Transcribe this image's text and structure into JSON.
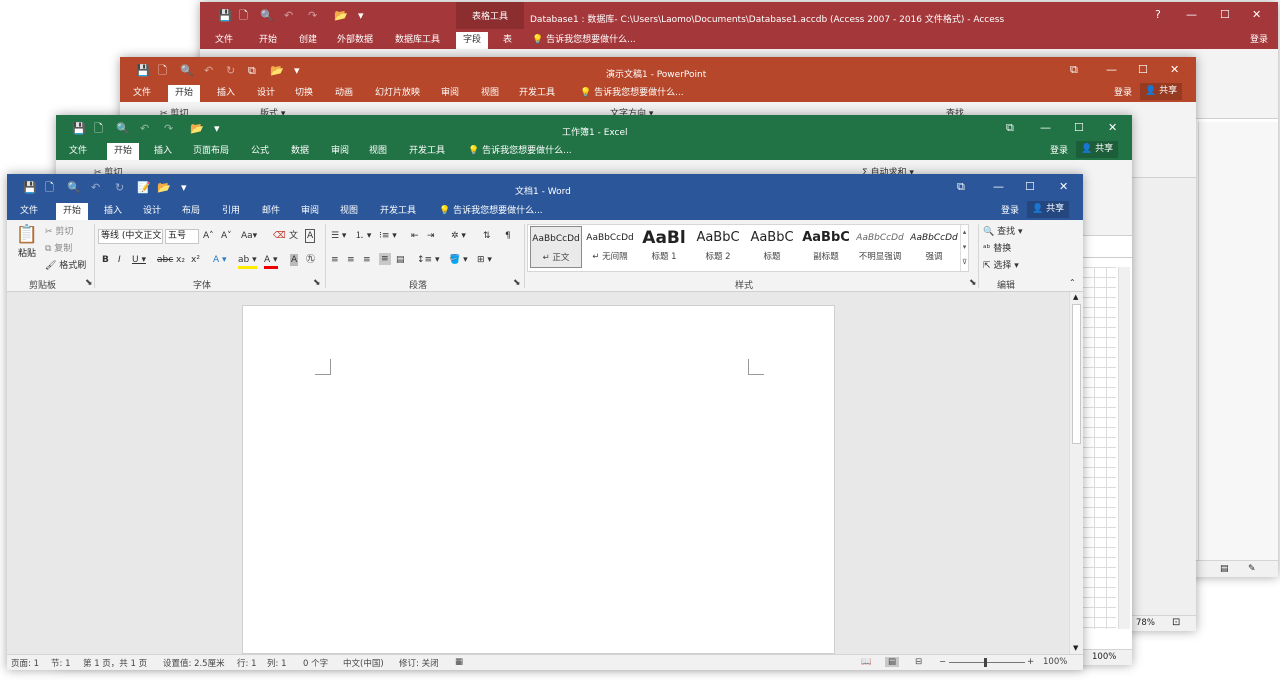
{
  "access": {
    "qat": [
      "💾",
      "🗋",
      "🔍",
      "↶",
      "↷",
      "📂",
      "▾"
    ],
    "context_tab": "表格工具",
    "title": "Database1 : 数据库- C:\\Users\\Laomo\\Documents\\Database1.accdb (Access 2007 - 2016 文件格式) - Access",
    "controls": [
      "?",
      "—",
      "☐",
      "✕"
    ],
    "tabs": [
      "文件",
      "开始",
      "创建",
      "外部数据",
      "数据库工具",
      "字段",
      "表"
    ],
    "active_tab": 5,
    "tell_me": "告诉我您想要做什么...",
    "login": "登录"
  },
  "ppt": {
    "qat": [
      "💾",
      "🗋",
      "🔍",
      "↶",
      "↻",
      "⧉",
      "📂",
      "▾"
    ],
    "title": "演示文稿1 - PowerPoint",
    "controls": [
      "⧉",
      "—",
      "☐",
      "✕"
    ],
    "tabs": [
      "文件",
      "开始",
      "插入",
      "设计",
      "切换",
      "动画",
      "幻灯片放映",
      "审阅",
      "视图",
      "开发工具"
    ],
    "active_tab": 1,
    "tell_me": "告诉我您想要做什么...",
    "login": "登录",
    "share": "共享",
    "ribbon_hint": [
      "✂ 剪切",
      "版式 ▾",
      "文字方向 ▾",
      "查找"
    ],
    "zoom": "78%"
  },
  "excel": {
    "qat": [
      "💾",
      "🗋",
      "🔍",
      "↶",
      "↷",
      "📂",
      "▾"
    ],
    "title": "工作簿1 - Excel",
    "controls": [
      "⧉",
      "—",
      "☐",
      "✕"
    ],
    "tabs": [
      "文件",
      "开始",
      "插入",
      "页面布局",
      "公式",
      "数据",
      "审阅",
      "视图",
      "开发工具"
    ],
    "active_tab": 1,
    "tell_me": "告诉我您想要做什么...",
    "login": "登录",
    "share": "共享",
    "ribbon_hint": [
      "✂ 剪切",
      "Σ 自动求和 ▾"
    ],
    "zoom": "100%"
  },
  "word": {
    "qat": [
      "💾",
      "🗋",
      "🔍",
      "↶",
      "↻",
      "📝",
      "📂",
      "▾"
    ],
    "title": "文档1 - Word",
    "controls": [
      "⧉",
      "—",
      "☐",
      "✕"
    ],
    "tabs": [
      "文件",
      "开始",
      "插入",
      "设计",
      "布局",
      "引用",
      "邮件",
      "审阅",
      "视图",
      "开发工具"
    ],
    "active_tab": 1,
    "tell_me": "告诉我您想要做什么...",
    "login": "登录",
    "share": "共享",
    "clipboard": {
      "paste": "粘贴",
      "cut": "剪切",
      "copy": "复制",
      "painter": "格式刷",
      "label": "剪贴板"
    },
    "font": {
      "name": "等线 (中文正文)",
      "size": "五号",
      "label": "字体"
    },
    "paragraph": {
      "label": "段落"
    },
    "styles": {
      "label": "样式",
      "items": [
        {
          "preview": "AaBbCcDd",
          "name": "↵ 正文"
        },
        {
          "preview": "AaBbCcDd",
          "name": "↵ 无间隔"
        },
        {
          "preview": "AaBl",
          "name": "标题 1"
        },
        {
          "preview": "AaBbC",
          "name": "标题 2"
        },
        {
          "preview": "AaBbC",
          "name": "标题"
        },
        {
          "preview": "AaBbC",
          "name": "副标题"
        },
        {
          "preview": "AaBbCcDd",
          "name": "不明显强调"
        },
        {
          "preview": "AaBbCcDd",
          "name": "强调"
        }
      ]
    },
    "editing": {
      "find": "查找",
      "replace": "替换",
      "select": "选择",
      "label": "编辑"
    },
    "status": {
      "page": "页面: 1",
      "section": "节: 1",
      "pages": "第 1 页，共 1 页",
      "setting": "设置值: 2.5厘米",
      "row": "行: 1",
      "col": "列: 1",
      "words": "0 个字",
      "lang": "中文(中国)",
      "track": "修订: 关闭",
      "zoom": "100%"
    }
  },
  "colors": {
    "access": "#a4373a",
    "ppt": "#b7472a",
    "excel": "#217346",
    "word": "#2b579a"
  }
}
